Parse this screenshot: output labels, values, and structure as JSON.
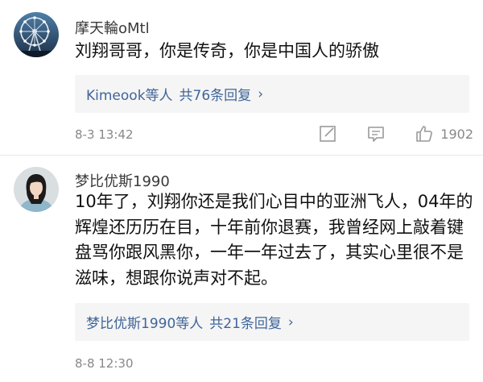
{
  "comments": [
    {
      "username": "摩天輪oMtl",
      "content": "刘翔哥哥，你是传奇，你是中国人的骄傲",
      "reply_users": "Kimeook等人",
      "reply_count": "共76条回复",
      "timestamp": "8-3 13:42",
      "likes": "1902",
      "avatar_icon": "ferris-wheel-avatar"
    },
    {
      "username": "梦比优斯1990",
      "content": "10年了，刘翔你还是我们心目中的亚洲飞人，04年的辉煌还历历在目，十年前你退赛，我曾经网上敲着键盘骂你跟风黑你，一年一年过去了，其实心里很不是滋味，想跟你说声对不起。",
      "reply_users": "梦比优斯1990等人",
      "reply_count": "共21条回复",
      "timestamp": "8-8 12:30",
      "avatar_icon": "person-avatar"
    }
  ],
  "colors": {
    "link": "#406599",
    "meta": "#888888",
    "reply_bg": "#f5f5f5"
  }
}
